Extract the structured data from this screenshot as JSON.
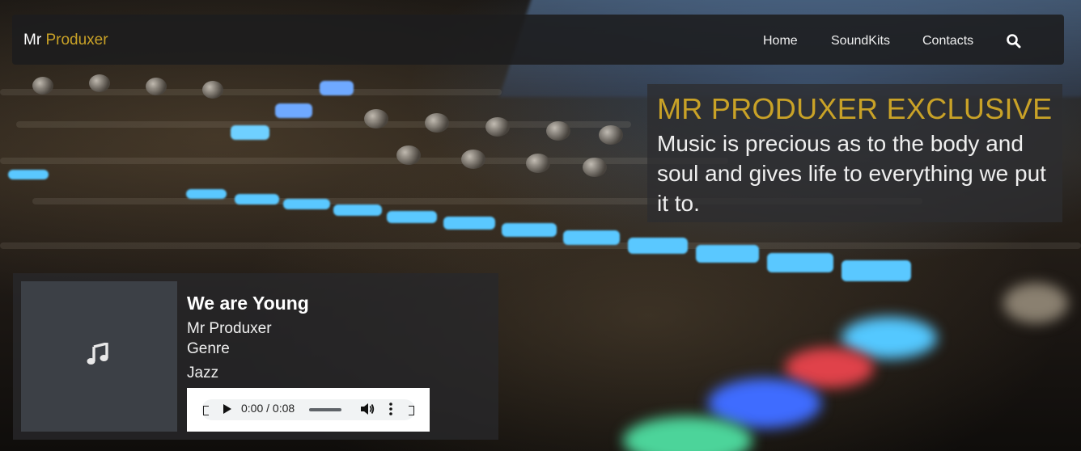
{
  "brand": {
    "first": "Mr",
    "second": "Produxer"
  },
  "nav": {
    "items": [
      "Home",
      "SoundKits",
      "Contacts"
    ],
    "search_icon": "search-icon"
  },
  "hero": {
    "title": "MR PRODUXER EXCLUSIVE",
    "text": "Music is precious as to the body and soul and gives life to everything we put it to."
  },
  "track": {
    "title": "We are Young",
    "artist": "Mr Produxer",
    "genre_label": "Genre",
    "genre": "Jazz",
    "cover_icon": "music-note-icon",
    "player": {
      "time": "0:00 / 0:08",
      "progress": 0
    }
  },
  "colors": {
    "accent": "#c9a227",
    "nav_bg": "#1c1c1e",
    "text": "#ffffff"
  }
}
